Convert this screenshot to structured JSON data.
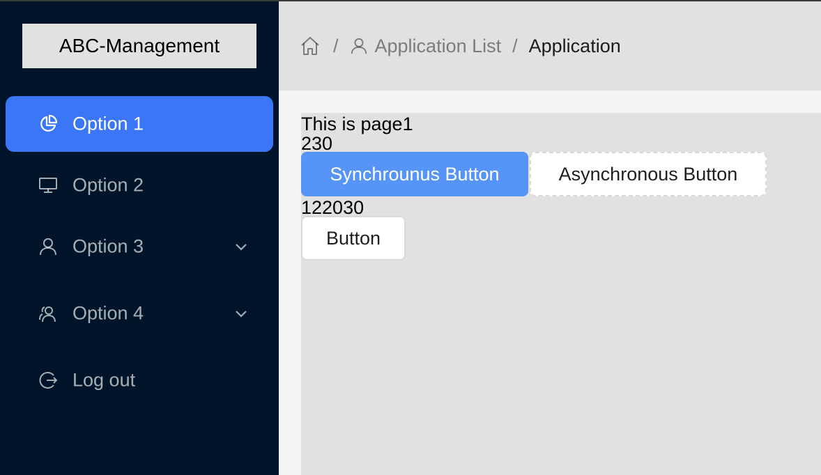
{
  "logo": {
    "text": "ABC-Management"
  },
  "sidebar": {
    "items": [
      {
        "label": "Option 1",
        "icon": "pie-chart-icon",
        "active": true
      },
      {
        "label": "Option 2",
        "icon": "desktop-icon"
      },
      {
        "label": "Option 3",
        "icon": "user-icon",
        "expandable": true
      },
      {
        "label": "Option 4",
        "icon": "team-icon",
        "expandable": true
      },
      {
        "label": "Log out",
        "icon": "logout-icon"
      }
    ]
  },
  "breadcrumb": {
    "items": [
      {
        "icon": "home-icon"
      },
      {
        "label": "Application List",
        "icon": "user-icon"
      },
      {
        "label": "Application"
      }
    ],
    "separator": "/"
  },
  "content": {
    "title": "This is page1",
    "count_1": "230",
    "sync_button": "Synchrounus Button",
    "async_button": "Asynchronous Button",
    "count_2": "122030",
    "button": "Button"
  },
  "colors": {
    "sidebar_bg": "#001529",
    "active_item": "#3a76f6",
    "primary_button": "#5794f7"
  }
}
